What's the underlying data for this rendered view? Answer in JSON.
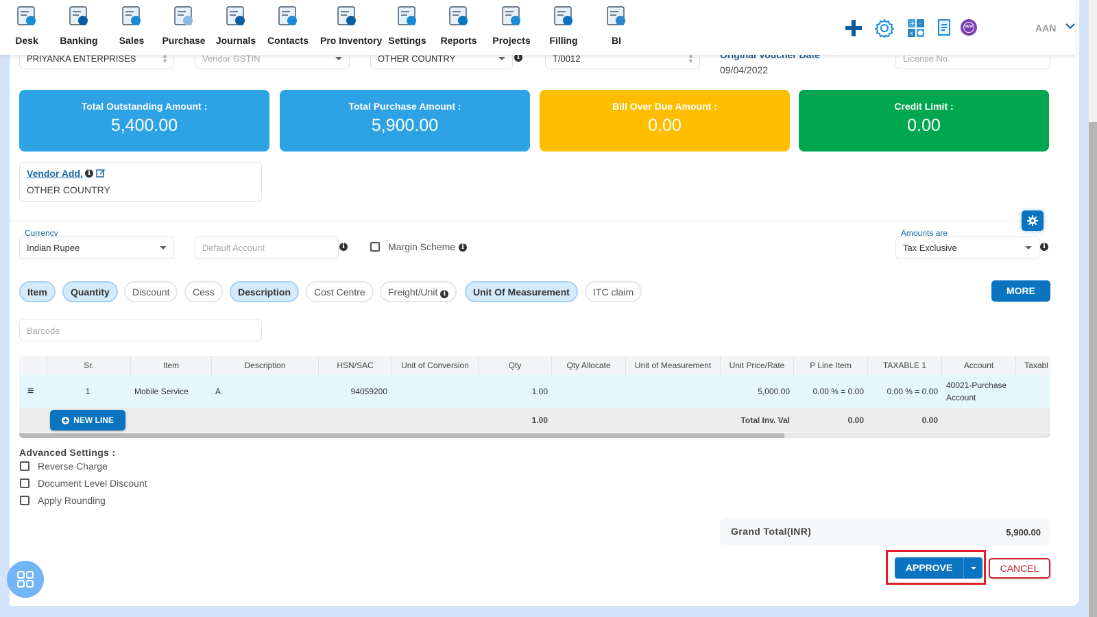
{
  "nav": {
    "items": [
      {
        "label": "Desk",
        "icon": "desk-icon"
      },
      {
        "label": "Banking",
        "icon": "bank-icon"
      },
      {
        "label": "Sales",
        "icon": "sales-icon"
      },
      {
        "label": "Purchase",
        "icon": "purchase-icon"
      },
      {
        "label": "Journals",
        "icon": "journals-icon"
      },
      {
        "label": "Contacts",
        "icon": "contacts-icon"
      },
      {
        "label": "Pro Inventory",
        "icon": "inventory-icon"
      },
      {
        "label": "Settings",
        "icon": "settings-tools-icon"
      },
      {
        "label": "Reports",
        "icon": "reports-icon"
      },
      {
        "label": "Projects",
        "icon": "projects-icon"
      },
      {
        "label": "Filling",
        "icon": "filling-icon"
      },
      {
        "label": "BI",
        "icon": "bi-icon"
      }
    ],
    "user": "AAN",
    "new_badge": "NEW"
  },
  "header_fields": {
    "vendor": "PRIYANKA ENTERPRISES",
    "vendor_gstin_placeholder": "Vendor GSTIN",
    "place_of_supply": "OTHER COUNTRY",
    "voucher_no": "T/0012",
    "original_voucher_date_label": "Original Voucher Date",
    "original_voucher_date": "09/04/2022",
    "license_placeholder": "License No"
  },
  "stats": [
    {
      "label": "Total Outstanding Amount :",
      "value": "5,400.00",
      "color": "#2da3e6"
    },
    {
      "label": "Total Purchase Amount :",
      "value": "5,900.00",
      "color": "#2da3e6"
    },
    {
      "label": "Bill Over Due Amount :",
      "value": "0.00",
      "color": "#fdbe00"
    },
    {
      "label": "Credit Limit :",
      "value": "0.00",
      "color": "#00a650"
    }
  ],
  "vendor_address": {
    "link": "Vendor Add.",
    "value": "OTHER COUNTRY"
  },
  "options": {
    "currency_label": "Currency",
    "currency": "Indian Rupee",
    "default_account_placeholder": "Default Account",
    "margin_scheme": "Margin Scheme",
    "amounts_are_label": "Amounts are",
    "amounts_are": "Tax Exclusive"
  },
  "chips": [
    {
      "label": "Item",
      "active": true
    },
    {
      "label": "Quantity",
      "active": true
    },
    {
      "label": "Discount",
      "active": false
    },
    {
      "label": "Cess",
      "active": false
    },
    {
      "label": "Description",
      "active": true
    },
    {
      "label": "Cost Centre",
      "active": false
    },
    {
      "label": "Freight/Unit",
      "active": false
    },
    {
      "label": "Unit Of Measurement",
      "active": true
    },
    {
      "label": "ITC claim",
      "active": false
    }
  ],
  "more_label": "MORE",
  "barcode_placeholder": "Barcode",
  "table": {
    "columns": [
      "",
      "Sr.",
      "Item",
      "Description",
      "HSN/SAC",
      "Unit of Conversion",
      "Qty",
      "Qty Allocate",
      "Unit of Measurement",
      "Unit Price/Rate",
      "P Line Item",
      "TAXABLE 1",
      "Account",
      "Taxabl"
    ],
    "rows": [
      {
        "sr": "1",
        "item": "Mobile Service",
        "description": "A",
        "hsn": "94059200",
        "unit_conversion": "",
        "qty": "1.00",
        "qty_allocate": "",
        "uom": "",
        "rate": "5,000.00",
        "p_line_item": "0.00 % = 0.00",
        "taxable1": "0.00 % = 0.00",
        "account_line1": "40021-Purchase",
        "account_line2": "Account"
      }
    ],
    "footer": {
      "qty_total": "1.00",
      "total_inv_label": "Total Inv. Val",
      "p_line_total": "0.00",
      "taxable1_total": "0.00"
    },
    "new_line_label": "NEW LINE"
  },
  "advanced": {
    "title": "Advanced Settings :",
    "options": [
      "Reverse Charge",
      "Document Level Discount",
      "Apply Rounding"
    ]
  },
  "grand_total": {
    "label": "Grand Total(INR)",
    "value": "5,900.00"
  },
  "actions": {
    "approve": "APPROVE",
    "cancel": "CANCEL"
  }
}
